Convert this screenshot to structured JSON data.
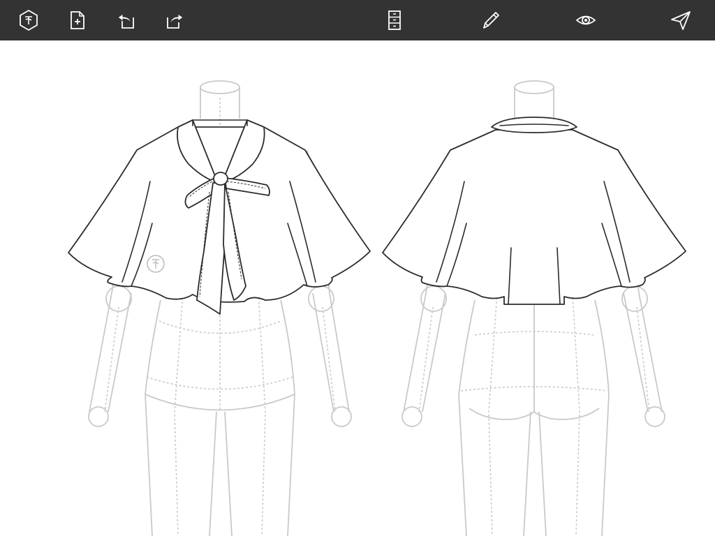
{
  "toolbar": {
    "buttons": [
      {
        "name": "logo-button",
        "icon": "hexagon-logo-icon"
      },
      {
        "name": "new-document-button",
        "icon": "new-document-icon"
      },
      {
        "name": "undo-button",
        "icon": "undo-icon"
      },
      {
        "name": "redo-button",
        "icon": "redo-icon"
      },
      {
        "name": "library-button",
        "icon": "drawers-icon"
      },
      {
        "name": "edit-button",
        "icon": "pencil-icon"
      },
      {
        "name": "preview-button",
        "icon": "eye-icon"
      },
      {
        "name": "share-button",
        "icon": "send-icon"
      }
    ]
  },
  "canvas": {
    "views": [
      "front",
      "back"
    ],
    "garment": "cape-blouse-with-pussy-bow"
  },
  "colors": {
    "toolbar_bg": "#333333",
    "icon": "#ffffff",
    "croquis": "#c9c9c9",
    "garment_stroke": "#2b2b2b"
  }
}
